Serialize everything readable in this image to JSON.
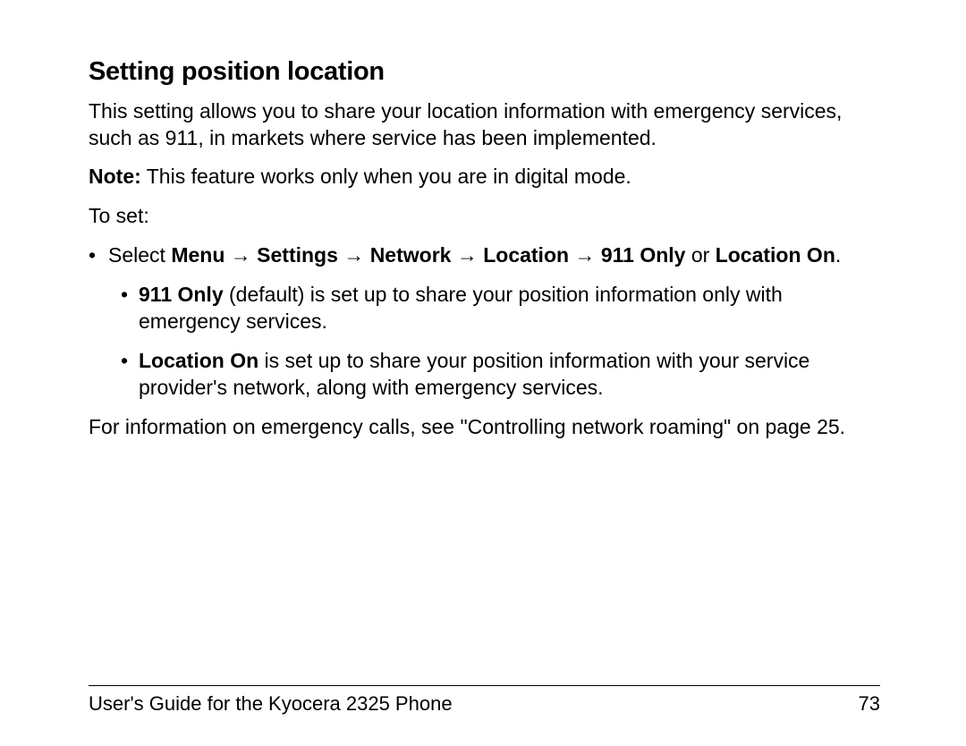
{
  "heading": "Setting position location",
  "intro": "This setting allows you to share your location information with emergency services, such as 911, in markets where service has been implemented.",
  "note_label": "Note:",
  "note_text": " This feature works only when you are in digital mode.",
  "toset": "To set:",
  "step_select": "Select ",
  "path": {
    "menu": "Menu",
    "settings": "Settings",
    "network": "Network",
    "location": "Location",
    "nineoneone": "911 Only"
  },
  "arrow": " → ",
  "step_or": " or ",
  "step_locon": "Location On",
  "step_period": ".",
  "sub1_bold": "911 Only",
  "sub1_rest": " (default) is set up to share your position information only with emergency services.",
  "sub2_bold": "Location On",
  "sub2_rest": " is set up to share your position information with your service provider's network, along with emergency services.",
  "crossref": "For information on emergency calls, see \"Controlling network roaming\" on page 25.",
  "footer_left": "User's Guide for the Kyocera 2325 Phone",
  "footer_right": "73"
}
